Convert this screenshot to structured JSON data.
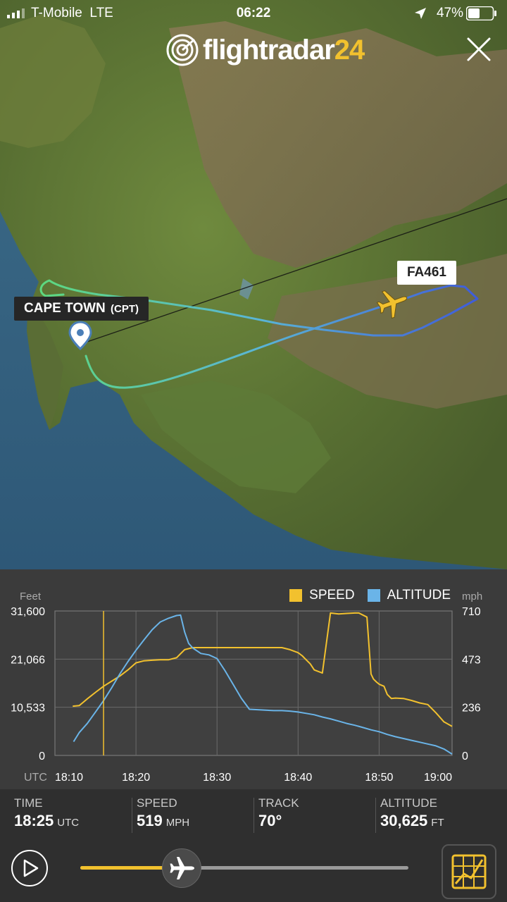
{
  "status_bar": {
    "carrier": "T-Mobile",
    "network": "LTE",
    "time": "06:22",
    "battery": "47%",
    "battery_level": 0.47
  },
  "header": {
    "logo_word": "flightradar",
    "logo_number": "24"
  },
  "map": {
    "airport_name": "CAPE TOWN",
    "airport_code": "(CPT)",
    "flight_label": "FA461"
  },
  "legend": {
    "speed_label": "SPEED",
    "altitude_label": "ALTITUDE",
    "speed_color": "#f2c12e",
    "altitude_color": "#6ab4e8"
  },
  "chart_data": {
    "type": "line",
    "left_axis_title": "Feet",
    "right_axis_title": "mph",
    "x_unit_label": "UTC",
    "x_ticks": [
      "18:10",
      "18:20",
      "18:30",
      "18:40",
      "18:50",
      "19:00"
    ],
    "y_left_ticks": [
      "31,600",
      "21,066",
      "10,533",
      "0"
    ],
    "y_right_ticks": [
      "710",
      "473",
      "236",
      "0"
    ],
    "xlim_minutes": [
      10,
      59
    ],
    "ylim_left": [
      0,
      31600
    ],
    "ylim_right": [
      0,
      710
    ],
    "cursor_minute": 16,
    "series": [
      {
        "name": "SPEED",
        "axis": "right",
        "color": "#f2c12e",
        "x": [
          12.2,
          13.0,
          13.4,
          14.0,
          15.0,
          16.0,
          17.0,
          18.0,
          19.0,
          20.0,
          21.0,
          22.0,
          23.0,
          24.0,
          25.0,
          26.0,
          27.0,
          28.0,
          29.0,
          30.0,
          31.0,
          32.0,
          33.0,
          34.0,
          35.0,
          36.0,
          37.0,
          38.0,
          39.0,
          40.0,
          40.5,
          41.0,
          41.5,
          42.0,
          43.0,
          44.0,
          45.0,
          46.0,
          47.0,
          47.5,
          48.0,
          48.5,
          49.0,
          49.3,
          49.7,
          50.0,
          50.3,
          50.6,
          51.0,
          51.5,
          52.0,
          53.0,
          54.0,
          55.0,
          56.0,
          57.0,
          58.0,
          59.0
        ],
        "values": [
          242,
          245,
          258,
          278,
          310,
          340,
          365,
          390,
          420,
          455,
          465,
          468,
          470,
          470,
          480,
          520,
          530,
          530,
          530,
          530,
          530,
          530,
          530,
          530,
          530,
          530,
          530,
          530,
          520,
          505,
          490,
          470,
          450,
          420,
          405,
          700,
          695,
          698,
          700,
          700,
          690,
          680,
          400,
          375,
          360,
          350,
          345,
          340,
          300,
          280,
          282,
          280,
          270,
          258,
          250,
          210,
          165,
          143
        ]
      },
      {
        "name": "ALTITUDE",
        "axis": "left",
        "color": "#6ab4e8",
        "x": [
          12.3,
          13.0,
          14.0,
          15.0,
          16.0,
          17.0,
          18.0,
          19.0,
          20.0,
          21.0,
          22.0,
          23.0,
          24.0,
          25.0,
          25.5,
          26.0,
          26.5,
          27.0,
          28.0,
          29.0,
          30.0,
          31.0,
          32.0,
          33.0,
          34.0,
          35.0,
          36.0,
          37.0,
          38.0,
          39.0,
          40.0,
          41.0,
          42.0,
          43.0,
          44.0,
          45.0,
          46.0,
          47.0,
          48.0,
          49.0,
          50.0,
          51.0,
          52.0,
          53.0,
          54.0,
          55.0,
          56.0,
          57.0,
          58.0,
          59.0
        ],
        "values": [
          3000,
          5000,
          7000,
          9500,
          12000,
          14800,
          17800,
          20500,
          23000,
          25300,
          27500,
          29200,
          30000,
          30600,
          30700,
          27000,
          24500,
          23500,
          22300,
          22000,
          21200,
          18500,
          15500,
          12500,
          10100,
          10000,
          9900,
          9800,
          9800,
          9700,
          9500,
          9200,
          8900,
          8400,
          8000,
          7500,
          7000,
          6600,
          6100,
          5600,
          5200,
          4600,
          4100,
          3700,
          3300,
          2900,
          2500,
          2100,
          1400,
          300
        ]
      }
    ]
  },
  "info": {
    "time_label": "TIME",
    "time_value": "18:25",
    "time_unit": "UTC",
    "speed_label": "SPEED",
    "speed_value": "519",
    "speed_unit": "MPH",
    "track_label": "TRACK",
    "track_value": "70°",
    "altitude_label": "ALTITUDE",
    "altitude_value": "30,625",
    "altitude_unit": "FT"
  },
  "playback": {
    "progress": 0.31
  },
  "icons": {
    "close": "close-icon",
    "play": "play-icon",
    "airplane": "airplane-icon",
    "chart_toggle": "chart-toggle-icon",
    "location": "location-arrow-icon",
    "airport_pin": "map-pin-icon"
  }
}
